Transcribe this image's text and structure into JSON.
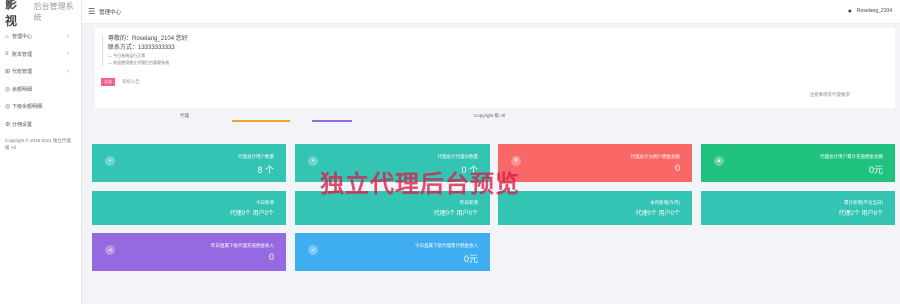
{
  "brand": {
    "name": "影视",
    "subtitle": "后台管理系统"
  },
  "sidebar": {
    "items": [
      {
        "label": "管理中心",
        "icon": "home-icon",
        "has_chevron": true
      },
      {
        "label": "账本管理",
        "icon": "list-icon",
        "has_chevron": true
      },
      {
        "label": "代收管理",
        "icon": "grid-icon",
        "has_chevron": true
      },
      {
        "label": "余额明细",
        "icon": "wallet-icon",
        "has_chevron": false
      },
      {
        "label": "下级余额明细",
        "icon": "wallet-icon",
        "has_chevron": false
      },
      {
        "label": "分佣设置",
        "icon": "settings-icon",
        "has_chevron": false
      }
    ],
    "copyright": "Copyright © 2016-2021 独立代理 版 All"
  },
  "topbar": {
    "breadcrumb": "管理中心",
    "username": "Roselang_2104"
  },
  "info": {
    "greeting": "尊敬的：Roselang_2104 您好",
    "contact": "联系方式：13333333333",
    "notes": [
      "— 今日系统运行正常",
      "— 欢迎使用独立代理后台管理系统"
    ],
    "tag": "公告",
    "link": "系统公告",
    "right_text": "注意事项及代理要求"
  },
  "strip": {
    "label_left": "代理",
    "label_right": "Copyright 版 All"
  },
  "cards_row1": [
    {
      "label": "代理总计用户数量",
      "value": "8 个",
      "color": "#33c4b3",
      "icon": "user-card-icon"
    },
    {
      "label": "代理总计代理分数量",
      "value": "0 个",
      "color": "#33c4b3",
      "icon": "user-card-icon"
    },
    {
      "label": "代理总计分佣户佣金总额",
      "value": "0",
      "color": "#f96766",
      "icon": "money-icon"
    },
    {
      "label": "代理总计用户累计充值佣金总额",
      "value": "0元",
      "color": "#21c27f",
      "icon": "coin-icon"
    }
  ],
  "cards_row2": [
    {
      "label": "今日新增",
      "value": "代理0个 用户0个",
      "color": "#33c4b3"
    },
    {
      "label": "昨日新增",
      "value": "代理0个 用户0个",
      "color": "#33c4b3"
    },
    {
      "label": "本月新增(今月)",
      "value": "代理0个 用户0个",
      "color": "#33c4b3"
    },
    {
      "label": "累计新增(不含当日)",
      "value": "代理2个 用户8个",
      "color": "#33c4b3"
    }
  ],
  "cards_row3": [
    {
      "label": "昨日直属下级代理充值佣金收入",
      "value": "0",
      "color": "#9569e0",
      "icon": "share-icon"
    },
    {
      "label": "今日直属下级代理累计佣金收入",
      "value": "0元",
      "color": "#3eaef0",
      "icon": "share-icon"
    }
  ],
  "watermark": "独立代理后台预览"
}
